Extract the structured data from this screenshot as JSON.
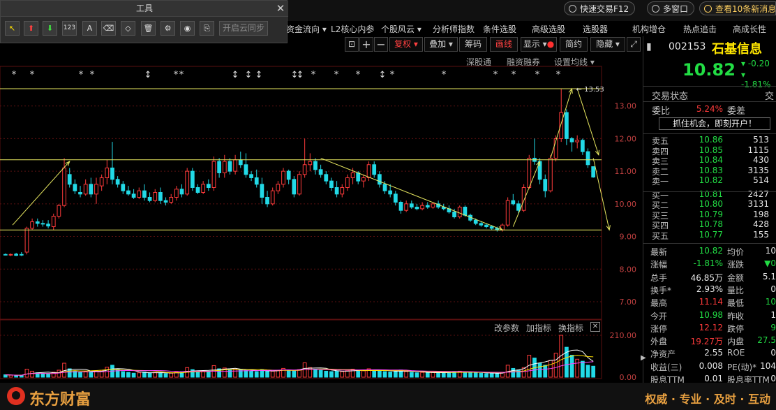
{
  "topbar": {
    "quick_trade": "快速交易F12",
    "multi_window": "多窗口",
    "news": "查看10条新消息"
  },
  "menu": [
    "资金流向",
    "L2核心内参",
    "个股风云",
    "分析师指数",
    "条件选股",
    "高级选股",
    "选股器",
    "机构增仓",
    "热点追击",
    "高成长性"
  ],
  "tool_panel": {
    "title": "工具",
    "buttons": [
      "cursor",
      "arrow-up",
      "arrow-down",
      "123",
      "A",
      "eraser",
      "eraser2",
      "trash",
      "gear",
      "eye",
      "screenshot"
    ],
    "cloud_sync": "开启云同步"
  },
  "chart_toolbar": {
    "fuquan": "复权",
    "overlay": "叠加",
    "chips": "筹码",
    "draw": "画线",
    "display": "显示",
    "simple": "简约",
    "hide": "隐藏"
  },
  "chart_sublinks": {
    "sh_hk": "深股通",
    "margin": "融资融券",
    "ma_setting": "设置均线"
  },
  "volume_panel": {
    "change_param": "改参数",
    "add_indicator": "加指标",
    "switch_indicator": "换指标"
  },
  "stock": {
    "code": "002153",
    "name": "石基信息",
    "price": "10.82",
    "change": "-0.20",
    "change_pct": "-1.81%"
  },
  "trade_status": {
    "label": "交易状态",
    "label2": "交",
    "weibi_label": "委比",
    "weibi_value": "5.24%",
    "weicha_label": "委差",
    "promo": "抓住机会，即刻开户！"
  },
  "order_book": {
    "asks": [
      {
        "label": "卖五",
        "price": "10.86",
        "vol": "513"
      },
      {
        "label": "卖四",
        "price": "10.85",
        "vol": "1115"
      },
      {
        "label": "卖三",
        "price": "10.84",
        "vol": "430"
      },
      {
        "label": "卖二",
        "price": "10.83",
        "vol": "3135"
      },
      {
        "label": "卖一",
        "price": "10.82",
        "vol": "514"
      }
    ],
    "bids": [
      {
        "label": "买一",
        "price": "10.81",
        "vol": "2427"
      },
      {
        "label": "买二",
        "price": "10.80",
        "vol": "3131"
      },
      {
        "label": "买三",
        "price": "10.79",
        "vol": "198"
      },
      {
        "label": "买四",
        "price": "10.78",
        "vol": "428"
      },
      {
        "label": "买五",
        "price": "10.77",
        "vol": "155"
      }
    ]
  },
  "stats": [
    {
      "l1": "最新",
      "v1": "10.82",
      "c1": "green",
      "l2": "均价",
      "v2": "10",
      "c2": "white"
    },
    {
      "l1": "涨幅",
      "v1": "-1.81%",
      "c1": "green",
      "l2": "涨跌",
      "v2": "▼0",
      "c2": "green"
    },
    {
      "l1": "总手",
      "v1": "46.85万",
      "c1": "white",
      "l2": "金额",
      "v2": "5.1",
      "c2": "white"
    },
    {
      "l1": "换手*",
      "v1": "2.93%",
      "c1": "white",
      "l2": "量比",
      "v2": "0",
      "c2": "white"
    },
    {
      "l1": "最高",
      "v1": "11.14",
      "c1": "red",
      "l2": "最低",
      "v2": "10",
      "c2": "green"
    },
    {
      "l1": "今开",
      "v1": "10.98",
      "c1": "green",
      "l2": "昨收",
      "v2": "1",
      "c2": "white"
    },
    {
      "l1": "涨停",
      "v1": "12.12",
      "c1": "red",
      "l2": "跌停",
      "v2": "9",
      "c2": "green"
    },
    {
      "l1": "外盘",
      "v1": "19.27万",
      "c1": "red",
      "l2": "内盘",
      "v2": "27.5",
      "c2": "green"
    },
    {
      "l1": "净资产",
      "v1": "2.55",
      "c1": "white",
      "l2": "ROE",
      "v2": "0",
      "c2": "white"
    },
    {
      "l1": "收益(三)",
      "v1": "0.008",
      "c1": "white",
      "l2": "PE(动)*",
      "v2": "104",
      "c2": "white"
    },
    {
      "l1": "股息TTM",
      "v1": "0.01",
      "c1": "white",
      "l2": "股息率TTM",
      "v2": "0",
      "c2": "white"
    }
  ],
  "bottom": {
    "brand": "东方财富",
    "slogan": "权威 · 专业 · 及时 · 互动"
  },
  "chart_data": {
    "type": "candlestick",
    "y_ticks": [
      "13.00",
      "12.00",
      "11.00",
      "10.00",
      "9.00",
      "8.00",
      "7.00"
    ],
    "ylim": [
      6.4,
      14.0
    ],
    "vol_ticks": [
      "210.00",
      "0.00"
    ],
    "vol_max": 210,
    "high_annotation": "13.53",
    "resistance": 11.35,
    "support": 9.2,
    "top_line": 13.53,
    "colors": {
      "up": "#ff3b3b",
      "down": "#22d9e6",
      "grid": "#5a1010",
      "line": "#e8e860"
    },
    "candles": [
      [
        8.45,
        8.48,
        8.42,
        8.44
      ],
      [
        8.44,
        8.48,
        8.4,
        8.45
      ],
      [
        8.46,
        8.5,
        8.4,
        8.42
      ],
      [
        8.45,
        8.52,
        8.4,
        8.44
      ],
      [
        8.52,
        9.3,
        8.45,
        9.25
      ],
      [
        9.25,
        9.55,
        9.2,
        9.45
      ],
      [
        9.45,
        9.55,
        9.3,
        9.4
      ],
      [
        9.4,
        9.5,
        9.3,
        9.38
      ],
      [
        9.38,
        9.5,
        9.25,
        9.32
      ],
      [
        9.3,
        9.7,
        9.2,
        9.62
      ],
      [
        9.62,
        10.0,
        9.55,
        9.95
      ],
      [
        9.95,
        11.4,
        9.9,
        11.1
      ],
      [
        10.9,
        11.1,
        10.5,
        10.6
      ],
      [
        10.6,
        10.75,
        10.3,
        10.4
      ],
      [
        10.35,
        10.55,
        10.2,
        10.3
      ],
      [
        10.3,
        10.75,
        10.25,
        10.6
      ],
      [
        10.6,
        10.8,
        10.2,
        10.3
      ],
      [
        10.3,
        10.8,
        10.0,
        10.6
      ],
      [
        10.55,
        10.9,
        10.4,
        10.8
      ],
      [
        10.8,
        11.35,
        10.6,
        11.1
      ],
      [
        11.1,
        11.9,
        10.6,
        10.75
      ],
      [
        10.75,
        10.85,
        10.5,
        10.6
      ],
      [
        10.6,
        10.7,
        10.3,
        10.4
      ],
      [
        10.4,
        10.55,
        10.25,
        10.3
      ],
      [
        10.3,
        10.45,
        10.15,
        10.2
      ],
      [
        10.2,
        10.5,
        10.15,
        10.4
      ],
      [
        10.4,
        10.6,
        10.1,
        10.2
      ],
      [
        10.2,
        10.35,
        10.05,
        10.1
      ],
      [
        10.1,
        10.45,
        10.05,
        10.35
      ],
      [
        10.35,
        10.5,
        10.0,
        10.1
      ],
      [
        10.1,
        10.2,
        9.95,
        10.05
      ],
      [
        10.05,
        10.3,
        10.0,
        10.2
      ],
      [
        10.2,
        10.55,
        10.1,
        10.45
      ],
      [
        10.45,
        10.6,
        10.2,
        10.3
      ],
      [
        10.3,
        11.1,
        10.25,
        11.0
      ],
      [
        11.0,
        11.1,
        10.4,
        10.5
      ],
      [
        10.5,
        10.6,
        10.3,
        10.35
      ],
      [
        10.35,
        10.7,
        10.3,
        10.6
      ],
      [
        10.6,
        10.75,
        10.4,
        10.5
      ],
      [
        10.5,
        11.45,
        10.4,
        11.3
      ],
      [
        11.3,
        11.4,
        10.8,
        10.95
      ],
      [
        10.95,
        11.5,
        10.8,
        11.3
      ],
      [
        11.3,
        11.4,
        10.9,
        11.0
      ],
      [
        11.0,
        11.5,
        10.9,
        11.35
      ],
      [
        11.35,
        11.6,
        11.1,
        11.2
      ],
      [
        11.2,
        11.55,
        10.8,
        10.9
      ],
      [
        10.9,
        11.0,
        10.7,
        10.8
      ],
      [
        10.8,
        11.05,
        10.5,
        10.6
      ],
      [
        10.6,
        10.8,
        10.0,
        10.2
      ],
      [
        10.2,
        10.4,
        9.9,
        10.0
      ],
      [
        10.0,
        10.5,
        9.95,
        10.4
      ],
      [
        10.4,
        10.7,
        10.3,
        10.6
      ],
      [
        10.6,
        11.1,
        10.5,
        11.0
      ],
      [
        11.0,
        11.05,
        10.6,
        10.75
      ],
      [
        10.75,
        10.85,
        10.2,
        10.3
      ],
      [
        10.3,
        11.0,
        10.25,
        10.9
      ],
      [
        10.9,
        12.0,
        10.8,
        11.2
      ],
      [
        11.2,
        11.55,
        11.0,
        11.3
      ],
      [
        11.3,
        11.4,
        10.9,
        11.05
      ],
      [
        11.05,
        11.2,
        10.8,
        10.9
      ],
      [
        10.9,
        11.0,
        10.6,
        10.7
      ],
      [
        10.7,
        10.8,
        10.4,
        10.5
      ],
      [
        10.5,
        10.7,
        10.2,
        10.3
      ],
      [
        10.3,
        10.6,
        10.2,
        10.5
      ],
      [
        10.5,
        10.9,
        10.4,
        10.8
      ],
      [
        10.8,
        11.1,
        10.6,
        10.95
      ],
      [
        10.95,
        11.0,
        10.6,
        10.7
      ],
      [
        10.7,
        10.9,
        10.5,
        10.8
      ],
      [
        10.8,
        11.3,
        10.7,
        11.2
      ],
      [
        11.2,
        11.3,
        10.8,
        10.9
      ],
      [
        10.9,
        11.0,
        10.5,
        10.6
      ],
      [
        10.6,
        10.7,
        10.3,
        10.4
      ],
      [
        10.4,
        10.6,
        10.2,
        10.3
      ],
      [
        10.3,
        10.4,
        9.95,
        10.05
      ],
      [
        10.05,
        10.1,
        9.7,
        9.8
      ],
      [
        9.8,
        10.1,
        9.75,
        10.0
      ],
      [
        10.0,
        10.1,
        9.85,
        9.9
      ],
      [
        9.9,
        10.0,
        9.8,
        9.85
      ],
      [
        9.85,
        10.05,
        9.8,
        9.95
      ],
      [
        9.95,
        10.05,
        9.85,
        9.9
      ],
      [
        9.9,
        10.05,
        9.85,
        10.0
      ],
      [
        10.0,
        10.1,
        9.85,
        9.9
      ],
      [
        9.9,
        10.0,
        9.8,
        9.85
      ],
      [
        9.85,
        9.95,
        9.7,
        9.75
      ],
      [
        9.75,
        9.85,
        9.55,
        9.6
      ],
      [
        9.6,
        9.95,
        9.55,
        9.9
      ],
      [
        9.9,
        9.95,
        9.6,
        9.65
      ],
      [
        9.65,
        9.7,
        9.45,
        9.5
      ],
      [
        9.5,
        9.55,
        9.35,
        9.4
      ],
      [
        9.4,
        9.45,
        9.3,
        9.35
      ],
      [
        9.35,
        9.4,
        9.25,
        9.3
      ],
      [
        9.3,
        9.35,
        9.2,
        9.25
      ],
      [
        9.25,
        9.3,
        9.15,
        9.2
      ],
      [
        9.2,
        9.4,
        9.15,
        9.35
      ],
      [
        9.35,
        10.2,
        9.3,
        10.1
      ],
      [
        10.1,
        10.3,
        9.95,
        10.0
      ],
      [
        10.0,
        10.1,
        9.7,
        9.8
      ],
      [
        9.8,
        10.6,
        9.75,
        10.5
      ],
      [
        10.5,
        11.5,
        10.45,
        11.4
      ],
      [
        11.4,
        12.0,
        11.2,
        11.3
      ],
      [
        11.3,
        11.4,
        10.6,
        10.75
      ],
      [
        10.75,
        10.9,
        10.2,
        10.4
      ],
      [
        10.4,
        11.5,
        10.35,
        11.4
      ],
      [
        11.4,
        12.1,
        11.3,
        12.0
      ],
      [
        12.0,
        13.53,
        11.9,
        12.8
      ],
      [
        12.8,
        12.9,
        11.8,
        12.0
      ],
      [
        12.0,
        12.05,
        11.6,
        11.9
      ],
      [
        11.9,
        12.1,
        11.7,
        11.95
      ],
      [
        11.95,
        12.0,
        11.5,
        11.6
      ],
      [
        11.6,
        11.7,
        11.1,
        11.2
      ],
      [
        11.14,
        11.14,
        10.8,
        10.82
      ]
    ],
    "volumes": [
      12,
      10,
      8,
      9,
      40,
      30,
      22,
      18,
      16,
      25,
      35,
      70,
      42,
      30,
      24,
      28,
      30,
      32,
      34,
      50,
      60,
      38,
      28,
      24,
      20,
      22,
      26,
      20,
      24,
      22,
      18,
      20,
      26,
      24,
      48,
      38,
      26,
      30,
      28,
      58,
      42,
      46,
      38,
      40,
      36,
      34,
      30,
      28,
      38,
      30,
      30,
      34,
      44,
      36,
      32,
      38,
      72,
      48,
      40,
      34,
      30,
      28,
      30,
      28,
      34,
      40,
      34,
      32,
      42,
      36,
      30,
      28,
      26,
      32,
      36,
      28,
      24,
      22,
      24,
      22,
      24,
      22,
      22,
      24,
      28,
      30,
      26,
      24,
      22,
      20,
      18,
      20,
      18,
      24,
      60,
      44,
      36,
      48,
      110,
      96,
      70,
      60,
      84,
      120,
      210,
      150,
      110,
      90,
      80,
      60,
      55
    ]
  }
}
